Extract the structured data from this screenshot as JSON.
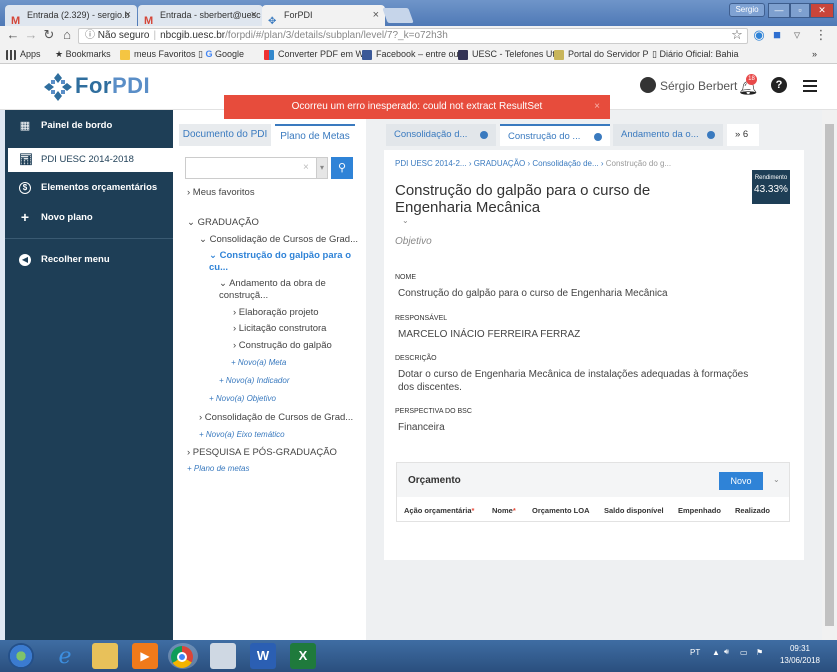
{
  "browser": {
    "tabs": [
      {
        "label": "Entrada (2.329) - sergio.b",
        "icon": "gmail-icon"
      },
      {
        "label": "Entrada - sberbert@uesc",
        "icon": "gmail-icon"
      },
      {
        "label": "ForPDI",
        "icon": "forpdi-icon"
      }
    ],
    "window_user": "Sergio",
    "security_label": "Não seguro",
    "url_host": "nbcgib.uesc.br",
    "url_path": "/forpdi/#/plan/3/details/subplan/level/7?_k=o72h3h",
    "bookmarks": [
      {
        "label": "Apps"
      },
      {
        "label": "Bookmarks"
      },
      {
        "label": "meus Favoritos"
      },
      {
        "label": "Google"
      },
      {
        "label": "Converter PDF em W"
      },
      {
        "label": "Facebook – entre ou"
      },
      {
        "label": "UESC - Telefones Ut"
      },
      {
        "label": "Portal do Servidor P"
      },
      {
        "label": "Diário Oficial: Bahia"
      }
    ]
  },
  "header": {
    "logo_for": "For",
    "logo_pdi": "PDI",
    "user_name": "Sérgio Berbert",
    "notif_count": "18",
    "help_label": "?"
  },
  "error_message": "Ocorreu um erro inesperado: could not extract ResultSet",
  "sidebar": {
    "items": [
      {
        "label": "Painel de bordo"
      },
      {
        "label": "PDI UESC 2014-2018"
      },
      {
        "label": "Elementos orçamentários"
      },
      {
        "label": "Novo plano"
      },
      {
        "label": "Recolher menu"
      }
    ]
  },
  "tree_panel": {
    "tabs": [
      "Documento do PDI",
      "Plano de Metas"
    ],
    "nodes": [
      "› Meus favoritos",
      "⌄ GRADUAÇÃO",
      "⌄ Consolidação de Cursos de Grad...",
      "⌄ Construção do galpão para o",
      "cu...",
      "⌄ Andamento da obra de",
      "construçã...",
      "› Elaboração projeto",
      "› Licitação construtora",
      "› Construção do galpão",
      "+ Novo(a) Meta",
      "+ Novo(a) Indicador",
      "+ Novo(a) Objetivo",
      "› Consolidação de Cursos de Grad...",
      "+ Novo(a) Eixo temático",
      "› PESQUISA E PÓS-GRADUAÇÃO",
      "+ Plano de metas"
    ]
  },
  "main": {
    "tabs": [
      "Consolidação d...",
      "Construção do ...",
      "Andamento da o...",
      "» 6"
    ],
    "breadcrumb": [
      "PDI UESC 2014-2...",
      "GRADUAÇÃO",
      "Consolidação de...",
      "Construção do g..."
    ],
    "title": "Construção do galpão para o curso de Engenharia Mecânica",
    "performance_label": "Rendimento",
    "performance_value": "43.33%",
    "subtitle": "Objetivo",
    "fields": [
      {
        "label": "NOME",
        "value": "Construção do galpão para o curso de Engenharia Mecânica"
      },
      {
        "label": "RESPONSÁVEL",
        "value": "MARCELO INÁCIO FERREIRA FERRAZ"
      },
      {
        "label": "DESCRIÇÃO",
        "value": "Dotar o curso de Engenharia Mecânica de instalações adequadas à formações dos discentes."
      },
      {
        "label": "PERSPECTIVA DO BSC",
        "value": "Financeira"
      }
    ],
    "budget": {
      "title": "Orçamento",
      "new_label": "Novo",
      "columns": [
        "Ação orçamentária",
        "Nome",
        "Orçamento LOA",
        "Saldo disponível",
        "Empenhado",
        "Realizado"
      ]
    }
  },
  "taskbar": {
    "lang": "PT",
    "time": "09:31",
    "date": "13/06/2018"
  }
}
